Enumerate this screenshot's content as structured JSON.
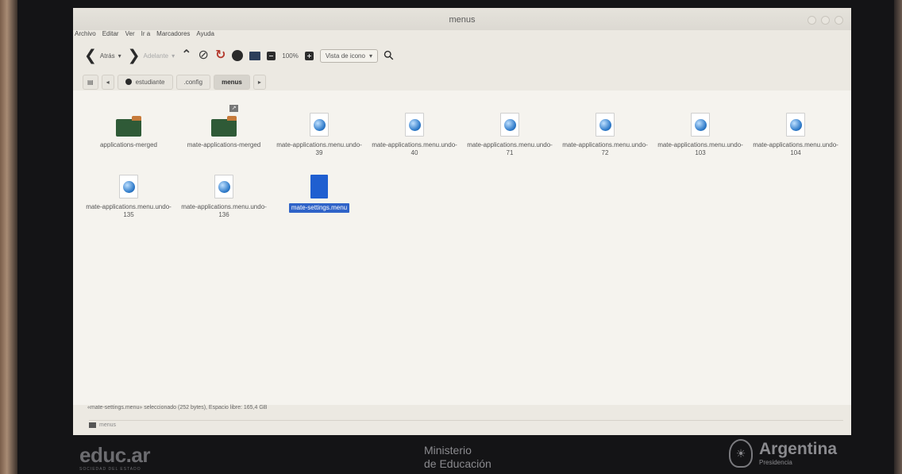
{
  "window": {
    "title": "menus"
  },
  "menubar": [
    "Archivo",
    "Editar",
    "Ver",
    "Ir a",
    "Marcadores",
    "Ayuda"
  ],
  "toolbar": {
    "back_label": "Atrás",
    "forward_label": "Adelante",
    "zoom": "100%",
    "view_mode": "Vista de icono"
  },
  "pathbar": {
    "crumbs": [
      "estudiante",
      ".config",
      "menus"
    ]
  },
  "files": [
    {
      "name": "applications-merged",
      "type": "folder"
    },
    {
      "name": "mate-applications-merged",
      "type": "folder-link"
    },
    {
      "name": "mate-applications.menu.undo-39",
      "type": "web-file"
    },
    {
      "name": "mate-applications.menu.undo-40",
      "type": "web-file"
    },
    {
      "name": "mate-applications.menu.undo-71",
      "type": "web-file"
    },
    {
      "name": "mate-applications.menu.undo-72",
      "type": "web-file"
    },
    {
      "name": "mate-applications.menu.undo-103",
      "type": "web-file"
    },
    {
      "name": "mate-applications.menu.undo-104",
      "type": "web-file"
    },
    {
      "name": "mate-applications.menu.undo-135",
      "type": "web-file"
    },
    {
      "name": "mate-applications.menu.undo-136",
      "type": "web-file"
    },
    {
      "name": "mate-settings.menu",
      "type": "file",
      "selected": true
    }
  ],
  "status": {
    "text": "«mate-settings.menu» seleccionado (252 bytes), Espacio libre: 165,4 GB",
    "bottom": "menus"
  },
  "bezel": {
    "logo_left": "educ.ar",
    "logo_left_sub": "SOCIEDAD DEL ESTADO",
    "center_line1": "Ministerio",
    "center_line2": "de Educación",
    "right_title": "Argentina",
    "right_sub": "Presidencia"
  },
  "colors": {
    "selection": "#2f63c8",
    "folder": "#2f5a37",
    "bezel": "#141416"
  }
}
